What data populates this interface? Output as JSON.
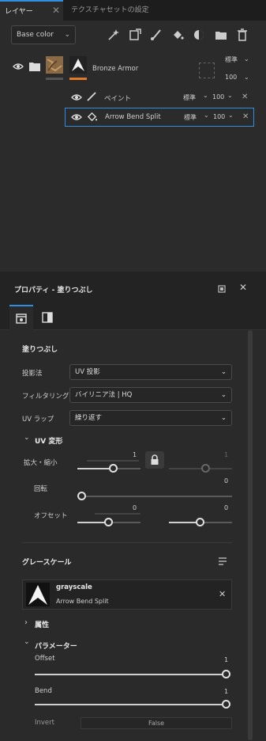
{
  "tabs": [
    {
      "label": "レイヤー"
    },
    {
      "label": "テクスチャセットの設定"
    }
  ],
  "toolbar": {
    "channel_select": "Base color"
  },
  "layers": {
    "group": {
      "name": "Bronze Armor",
      "blend": "標準",
      "opacity": "100"
    },
    "paint": {
      "name": "ペイント",
      "blend": "標準",
      "opacity": "100"
    },
    "fill": {
      "name": "Arrow Bend Split",
      "blend": "標準",
      "opacity": "100"
    }
  },
  "properties": {
    "title": "プロパティ - 塗りつぶし",
    "fill_section": "塗りつぶし",
    "projection_label": "投影法",
    "projection_value": "UV 投影",
    "filtering_label": "フィルタリング",
    "filtering_value": "バイリニア法 | HQ",
    "uvwrap_label": "UV ラップ",
    "uvwrap_value": "繰り返す",
    "uv_transform": "UV 変形",
    "scale_label": "拡大・縮小",
    "scale_value": "1",
    "scale_value2": "1",
    "rotation_label": "回転",
    "rotation_value": "0",
    "offset_label": "オフセット",
    "offset_x": "0",
    "offset_y": "0",
    "grayscale_section": "グレースケール",
    "grayscale_resource_title": "grayscale",
    "grayscale_resource_name": "Arrow Bend Split",
    "attributes": "属性",
    "parameters": "パラメーター",
    "param_offset_label": "Offset",
    "param_offset_value": "1",
    "param_bend_label": "Bend",
    "param_bend_value": "1",
    "param_invert_label": "Invert",
    "param_invert_value": "False"
  },
  "colors": {
    "accent": "#2f8ee0",
    "mask_bar": "#e07b2a"
  }
}
